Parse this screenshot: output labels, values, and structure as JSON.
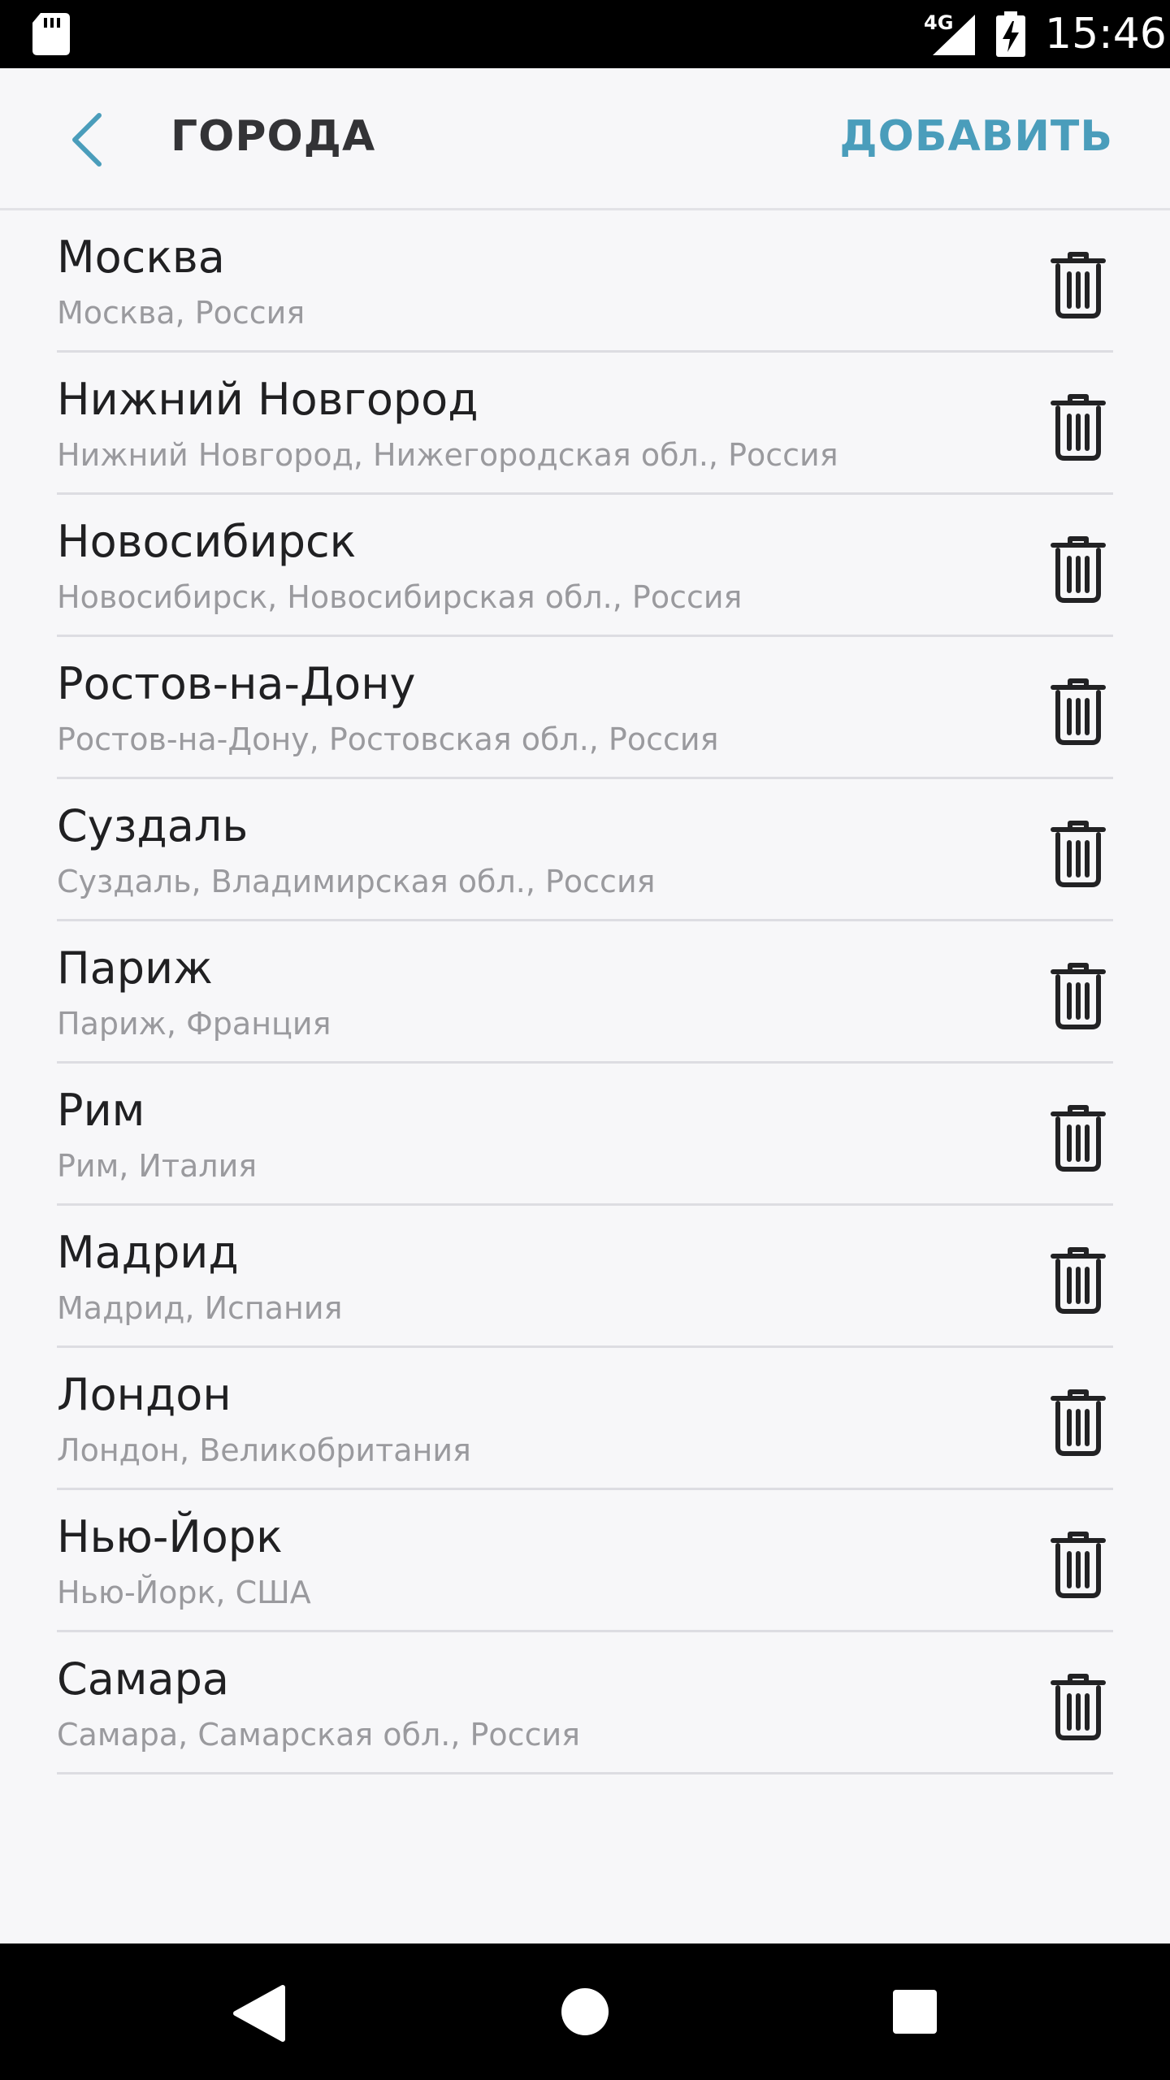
{
  "status_bar": {
    "network_type": "4G",
    "time": "15:46",
    "icons": [
      "sd-card-icon",
      "signal-icon",
      "battery-charging-icon"
    ]
  },
  "header": {
    "back_icon": "chevron-left-icon",
    "title": "ГОРОДА",
    "add_label": "ДОБАВИТЬ"
  },
  "colors": {
    "accent": "#4a9dbb",
    "background": "#f7f7f9",
    "title_text": "#333336",
    "primary_text": "#202022",
    "secondary_text": "#9a9a9e",
    "divider": "#dddde2"
  },
  "cities": [
    {
      "name": "Москва",
      "detail": "Москва, Россия",
      "action_icon": "trash-icon"
    },
    {
      "name": "Нижний Новгород",
      "detail": "Нижний Новгород, Нижегородская обл., Россия",
      "action_icon": "trash-icon"
    },
    {
      "name": "Новосибирск",
      "detail": "Новосибирск, Новосибирская обл., Россия",
      "action_icon": "trash-icon"
    },
    {
      "name": "Ростов-на-Дону",
      "detail": "Ростов-на-Дону, Ростовская обл., Россия",
      "action_icon": "trash-icon"
    },
    {
      "name": "Суздаль",
      "detail": "Суздаль, Владимирская обл., Россия",
      "action_icon": "trash-icon"
    },
    {
      "name": "Париж",
      "detail": "Париж, Франция",
      "action_icon": "trash-icon"
    },
    {
      "name": "Рим",
      "detail": "Рим, Италия",
      "action_icon": "trash-icon"
    },
    {
      "name": "Мадрид",
      "detail": "Мадрид, Испания",
      "action_icon": "trash-icon"
    },
    {
      "name": "Лондон",
      "detail": "Лондон, Великобритания",
      "action_icon": "trash-icon"
    },
    {
      "name": "Нью-Йорк",
      "detail": "Нью-Йорк, США",
      "action_icon": "trash-icon"
    },
    {
      "name": "Самара",
      "detail": "Самара, Самарская обл., Россия",
      "action_icon": "trash-icon"
    }
  ],
  "nav_bar": {
    "icons": [
      "nav-back-icon",
      "nav-home-icon",
      "nav-recents-icon"
    ]
  }
}
